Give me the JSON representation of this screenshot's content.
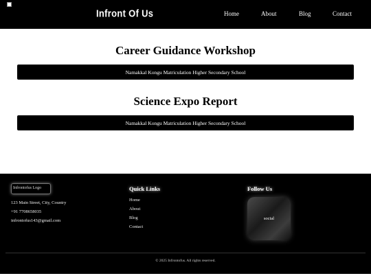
{
  "header": {
    "brand": "Infront Of Us",
    "nav": [
      "Home",
      "About",
      "Blog",
      "Contact"
    ]
  },
  "sections": [
    {
      "title": "Career Guidance Workshop",
      "school": "Namakkal Kongu Matriculation Higher Secondary School"
    },
    {
      "title": "Science Expo Report",
      "school": "Namakkal Kongu Matriculation Higher Secondary School"
    }
  ],
  "footer": {
    "logo_alt": "Infrontofus Logo",
    "address": "123 Main Street, City, Country",
    "phone": "+91 7708658035",
    "email": "infrontofus143@gmail.com",
    "quick_links_heading": "Quick Links",
    "quick_links": [
      "Home",
      "About",
      "Blog",
      "Contact"
    ],
    "follow_heading": "Follow Us",
    "social_label": "social",
    "copyright": "© 2025 Infrontofus. All rights reserved."
  }
}
